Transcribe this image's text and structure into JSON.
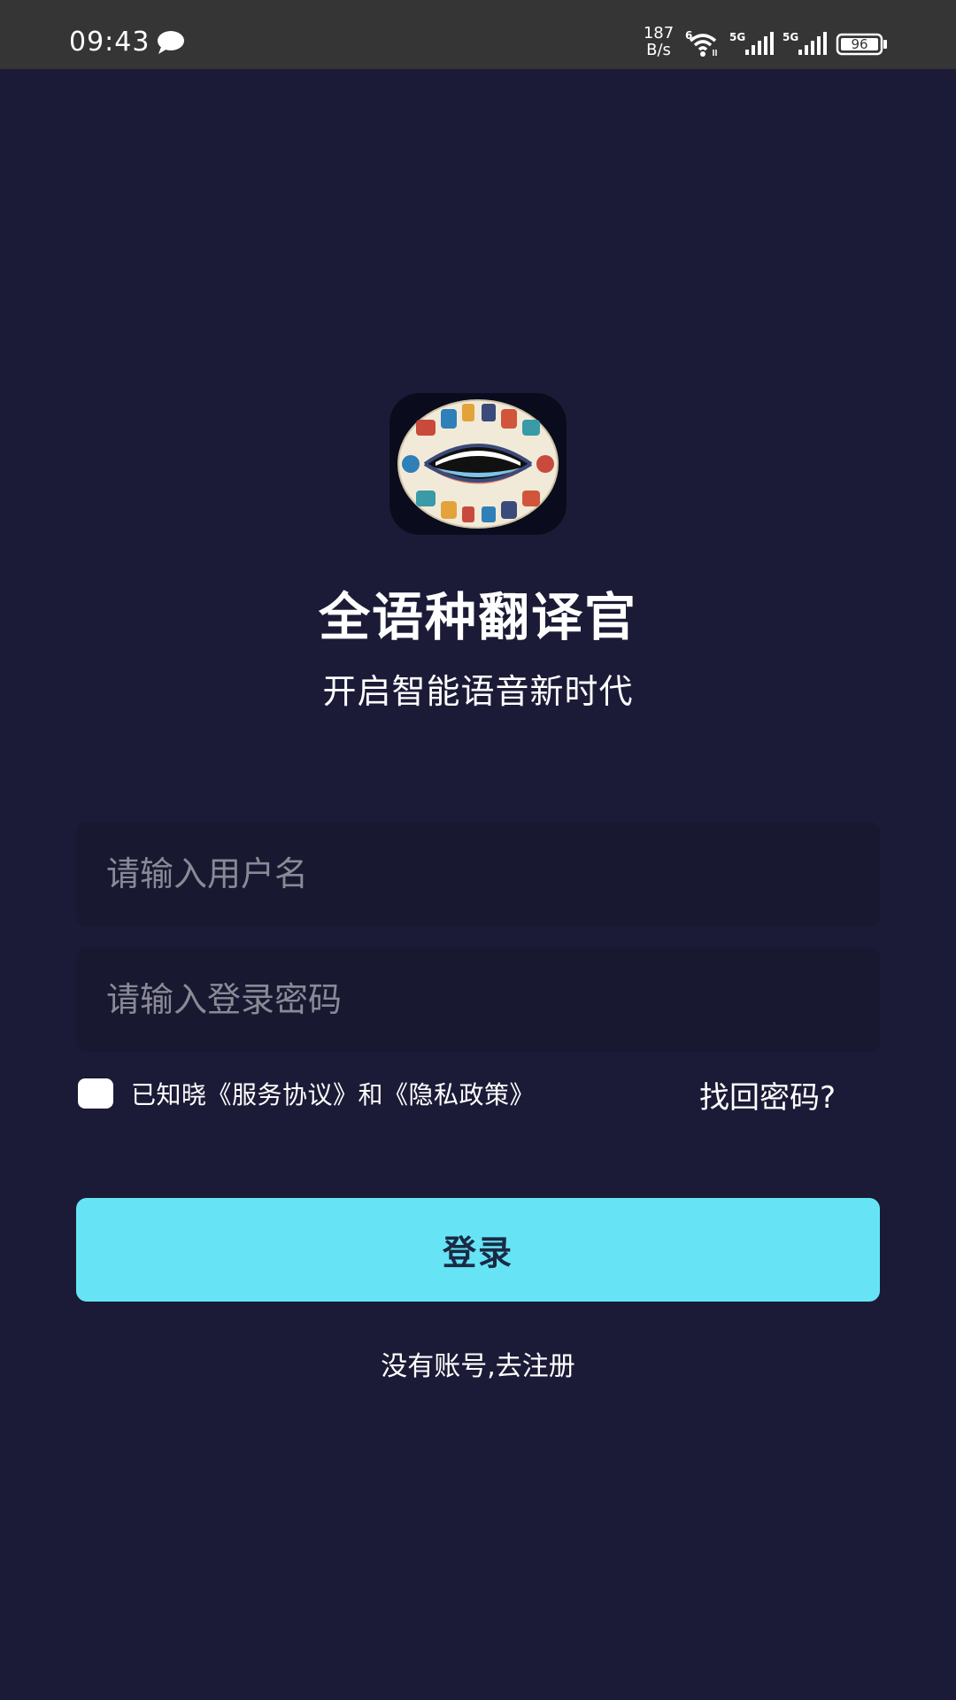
{
  "status_bar": {
    "time": "09:43",
    "speed_value": "187",
    "speed_unit": "B/s",
    "wifi_label": "6",
    "sim1_label": "5G",
    "sim2_label": "5G",
    "battery": "96"
  },
  "app": {
    "title": "全语种翻译官",
    "subtitle": "开启智能语音新时代"
  },
  "form": {
    "username_placeholder": "请输入用户名",
    "password_placeholder": "请输入登录密码",
    "agreement_text": "已知晓《服务协议》和《隐私政策》",
    "forgot_password": "找回密码?",
    "login_button": "登录",
    "register_link": "没有账号,去注册"
  },
  "colors": {
    "background": "#1b1b37",
    "status_bar": "#353535",
    "input_bg": "#181831",
    "accent": "#66e4f6"
  }
}
